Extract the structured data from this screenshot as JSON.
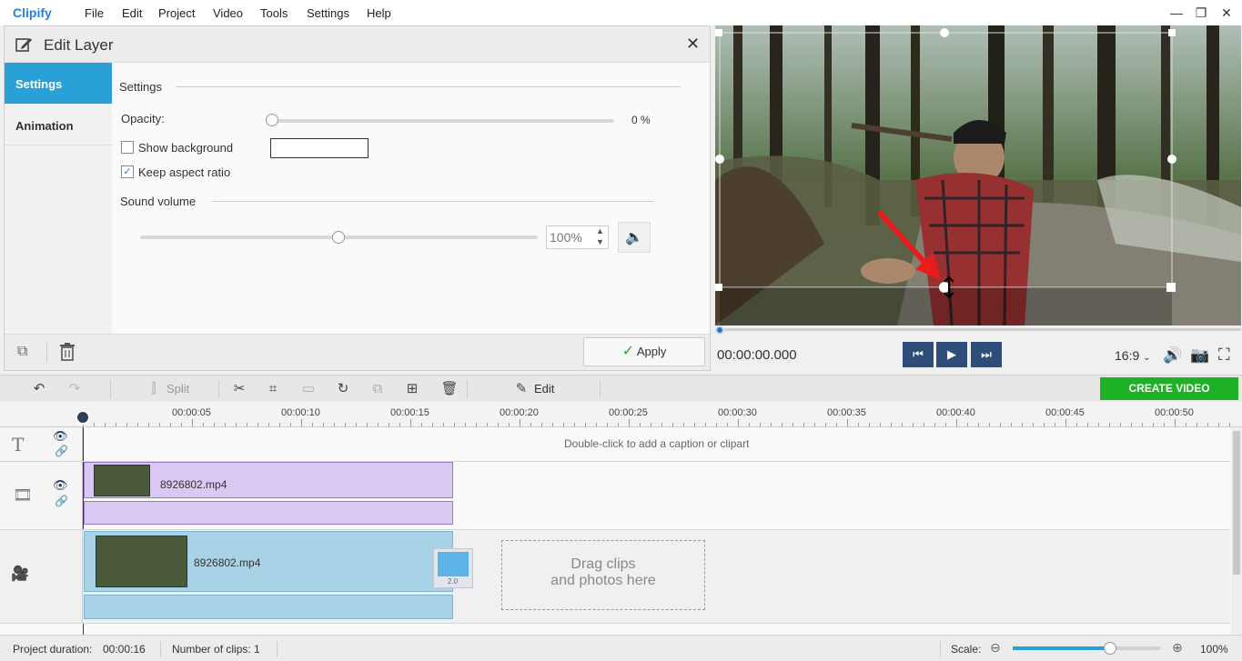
{
  "app": {
    "logo": "Clipify",
    "menu": [
      "File",
      "Edit",
      "Project",
      "Video",
      "Tools",
      "Settings",
      "Help"
    ]
  },
  "edit_layer": {
    "title": "Edit Layer",
    "tabs": [
      {
        "label": "Settings",
        "active": true
      },
      {
        "label": "Animation",
        "active": false
      }
    ],
    "section_title": "Settings",
    "opacity_label": "Opacity:",
    "opacity_value": "0 %",
    "opacity_fraction": 0.0,
    "show_background_label": "Show background",
    "show_background_checked": false,
    "background_color": "#ffffff",
    "keep_aspect_label": "Keep aspect ratio",
    "keep_aspect_checked": true,
    "sound_volume_label": "Sound volume",
    "volume_value": "100%",
    "volume_fraction": 0.5,
    "apply_label": "Apply"
  },
  "player": {
    "timecode": "00:00:00.000",
    "aspect": "16:9"
  },
  "toolbar": {
    "split_label": "Split",
    "edit_label": "Edit",
    "create_label": "CREATE VIDEO"
  },
  "ruler": {
    "labels": [
      "00:00:05",
      "00:00:10",
      "00:00:15",
      "00:00:20",
      "00:00:25",
      "00:00:30",
      "00:00:35",
      "00:00:40",
      "00:00:45",
      "00:00:50"
    ]
  },
  "timeline": {
    "caption_hint": "Double-click to add a caption or clipart",
    "overlay_clip": "8926802.mp4",
    "main_clip": "8926802.mp4",
    "transition_label": "2.0",
    "dropzone_line1": "Drag clips",
    "dropzone_line2": "and photos here"
  },
  "status": {
    "duration_label": "Project duration:",
    "duration_value": "00:00:16",
    "clips_label": "Number of clips: 1",
    "scale_label": "Scale:",
    "scale_value": "100%",
    "scale_fraction": 0.66
  },
  "colors": {
    "accent_blue": "#2aa0d8",
    "create_green": "#1fb125",
    "player_button": "#2f4d7a",
    "overlay_clip": "#d9c8f2",
    "main_clip": "#a8d3e6",
    "arrow_red": "#e81c1c"
  }
}
